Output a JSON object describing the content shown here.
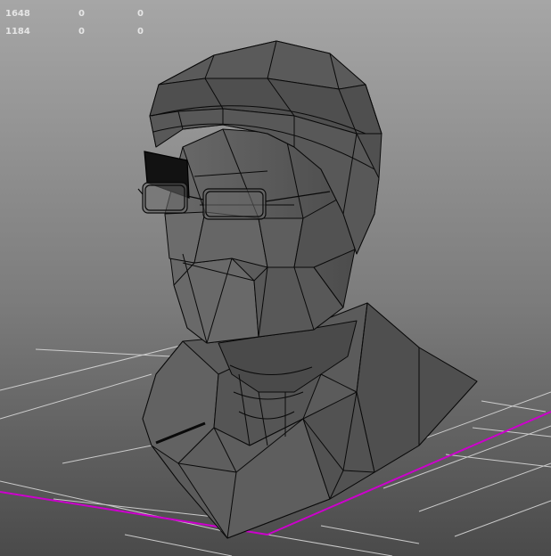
{
  "viewport": {
    "background_top": "#a6a6a6",
    "background_bottom": "#4a4a4a",
    "grid_color": "#d7d7d7",
    "axis_color": "#cc00cc",
    "mesh_fill": "#5c5c5c",
    "mesh_wire": "#0a0a0a"
  },
  "hud": {
    "rows": [
      {
        "label": "1648",
        "col2": "0",
        "col3": "0"
      },
      {
        "label": "1184",
        "col2": "0",
        "col3": "0"
      }
    ]
  }
}
